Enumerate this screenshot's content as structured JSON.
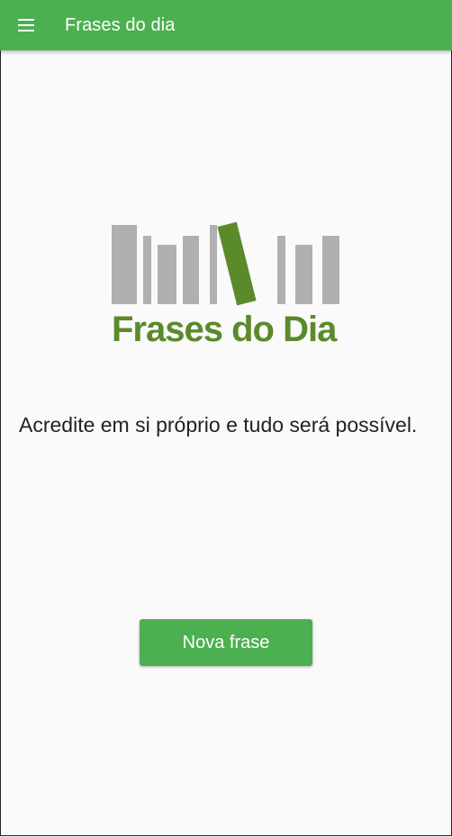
{
  "appbar": {
    "title": "Frases do dia",
    "color": "#4caf50",
    "menu_icon": "hamburger-menu-icon"
  },
  "logo": {
    "text": "Frases do Dia",
    "bar_color": "#b0b0b0",
    "accent_color": "#5a8a2a"
  },
  "main": {
    "quote": "Acredite em si próprio e tudo será possível."
  },
  "actions": {
    "new_quote_label": "Nova frase"
  }
}
